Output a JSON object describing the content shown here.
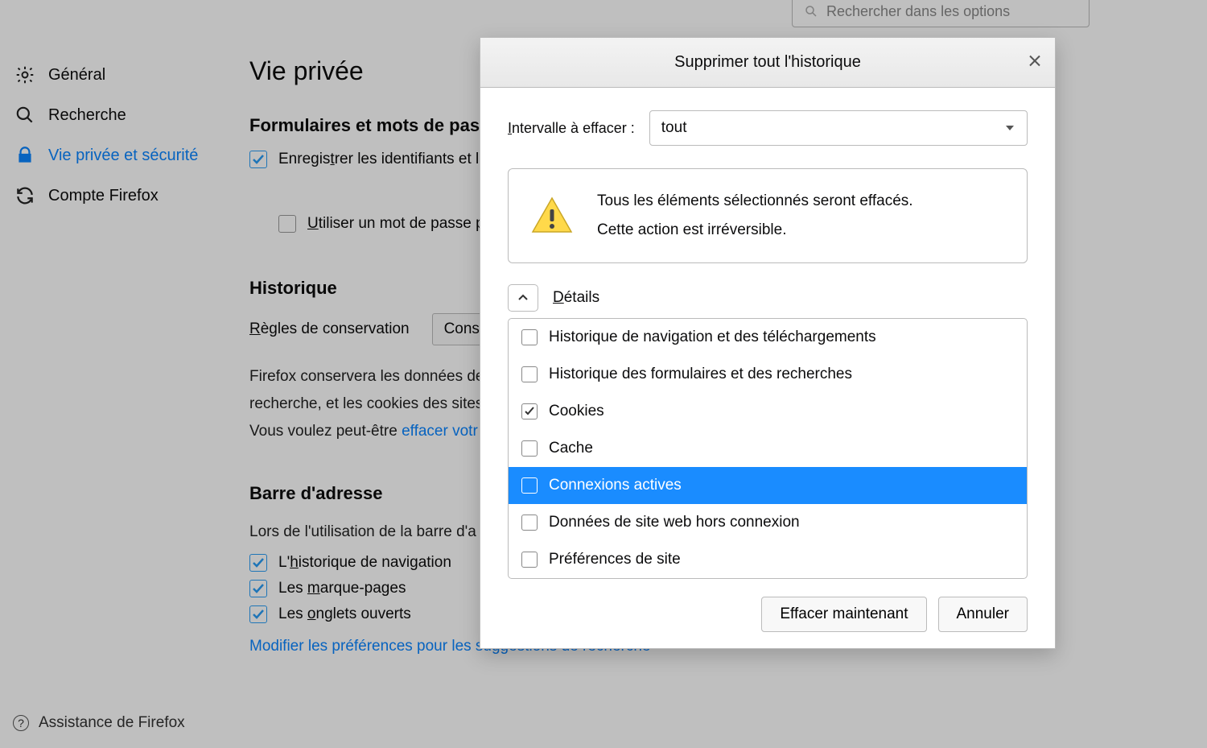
{
  "search": {
    "placeholder": "Rechercher dans les options"
  },
  "sidebar": {
    "items": [
      {
        "label": "Général",
        "icon": "gear"
      },
      {
        "label": "Recherche",
        "icon": "search"
      },
      {
        "label": "Vie privée et sécurité",
        "icon": "lock",
        "active": true
      },
      {
        "label": "Compte Firefox",
        "icon": "sync"
      }
    ]
  },
  "footer": {
    "label": "Assistance de Firefox"
  },
  "main": {
    "title": "Vie privée",
    "forms_section": {
      "title": "Formulaires et mots de passe",
      "cb_record": "Enregistrer les identifiants et l",
      "cb_master": "Utiliser un mot de passe princ"
    },
    "history_section": {
      "title": "Historique",
      "rules_label": "Règles de conservation",
      "rules_value": "Conserv",
      "desc_line1": "Firefox conservera les données de",
      "desc_line2": "recherche, et les cookies des sites",
      "desc_line3a": "Vous voulez peut-être ",
      "desc_line3b": "effacer votr"
    },
    "address_section": {
      "title": "Barre d'adresse",
      "desc": "Lors de l'utilisation de la barre d'a",
      "cb_history": "L'historique de navigation",
      "cb_bookmarks": "Les marque-pages",
      "cb_tabs": "Les onglets ouverts",
      "pref_link": "Modifier les préférences pour les suggestions de recherche"
    }
  },
  "dialog": {
    "title": "Supprimer tout l'historique",
    "range_label": "Intervalle à effacer :",
    "range_value": "tout",
    "warn_line1": "Tous les éléments sélectionnés seront effacés.",
    "warn_line2": "Cette action est irréversible.",
    "details_label": "Détails",
    "items": [
      {
        "label": "Historique de navigation et des téléchargements",
        "checked": false
      },
      {
        "label": "Historique des formulaires et des recherches",
        "checked": false
      },
      {
        "label": "Cookies",
        "checked": true
      },
      {
        "label": "Cache",
        "checked": false
      },
      {
        "label": "Connexions actives",
        "checked": false,
        "selected": true
      },
      {
        "label": "Données de site web hors connexion",
        "checked": false
      },
      {
        "label": "Préférences de site",
        "checked": false
      }
    ],
    "btn_clear": "Effacer maintenant",
    "btn_cancel": "Annuler"
  }
}
